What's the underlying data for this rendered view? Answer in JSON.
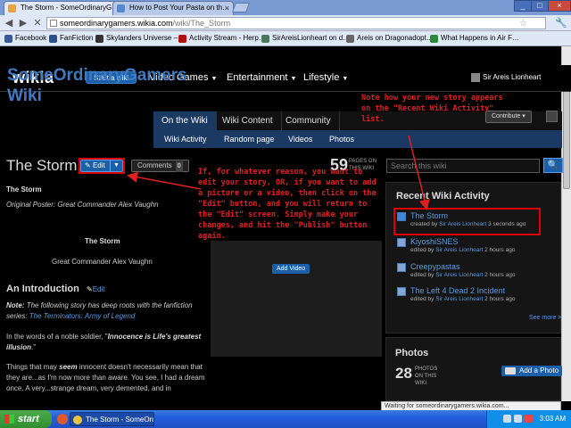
{
  "browser": {
    "tabs": [
      {
        "label": "The Storm - SomeOrdinaryG…",
        "active": true
      },
      {
        "label": "How to Post Your Pasta on th…",
        "active": false
      }
    ],
    "url_host": "someordinarygamers.wikia.com",
    "url_path": "/wiki/The_Storm",
    "bookmarks": [
      {
        "label": "Facebook",
        "color": "#3b5998"
      },
      {
        "label": "FanFiction",
        "color": "#2a4f8a"
      },
      {
        "label": "Skylanders Universe –…",
        "color": "#333333"
      },
      {
        "label": "Activity Stream - Herp…",
        "color": "#b01010"
      },
      {
        "label": "SirAreisLionheart on d…",
        "color": "#4a7a5a"
      },
      {
        "label": "Areis on Dragonadopt…",
        "color": "#666666"
      },
      {
        "label": "What Happens in Air F…",
        "color": "#2a8a3a"
      }
    ],
    "status_text": "Waiting for someordinarygamers.wikia.com..."
  },
  "wikia": {
    "logo": "wikia",
    "start_wiki": "Start a wiki",
    "hubs": [
      "Video Games",
      "Entertainment",
      "Lifestyle"
    ],
    "user": "Sir Areis Lionheart"
  },
  "wiki": {
    "title": "SomeOrdinaryGamers Wiki",
    "tabs": [
      "On the Wiki",
      "Wiki Content",
      "Community"
    ],
    "subtabs": [
      "Wiki Activity",
      "Random page",
      "Videos",
      "Photos"
    ],
    "contribute": "Contribute"
  },
  "article": {
    "title": "The Storm",
    "edit_label": "Edit",
    "comments_label": "Comments",
    "comments_count": "0",
    "pages_count": "59",
    "pages_label": "PAGES ON THIS WIKI",
    "search_placeholder": "Search this wiki",
    "heading_bold": "The Storm",
    "original_poster": "Original Poster: Great Commander Alex Vaughn",
    "center_title": "The Storm",
    "center_author": "Great Commander Alex Vaughn",
    "add_video": "Add Video",
    "intro_heading": "An Introduction",
    "intro_edit": "Edit",
    "note_label": "Note:",
    "note_text": "The following story has deep roots with the fanfiction series:",
    "note_link": "The Terminators: Army of Legend",
    "para1_start": "In the words of a noble soldier, \"",
    "para1_bold": "Innocence is Life's greatest illusion",
    "para1_end": ".\"",
    "para2_start": "Things that may ",
    "para2_bold": "seem",
    "para2_rest": " innocent doesn't necessarily mean that they are...as I'm now more than aware. You see, I had a dream once. A very...strange dream, very demented, and in"
  },
  "annotations": {
    "top_right": "Note how your new story appears on the \"Recent Wiki Activity\" list.",
    "middle": "If, for whatever reason, you want to edit your story, OR, if you want to add a picture or a video, then click on the \"Edit\" button, and you will return to the \"Edit\" screen. Simply make your changes, and hit the \"Publish\" button again."
  },
  "activity": {
    "heading": "Recent Wiki Activity",
    "items": [
      {
        "title": "The Storm",
        "meta_prefix": "created by ",
        "user": "Sir Areis Lionheart",
        "time": " 3 seconds ago"
      },
      {
        "title": "KiyoshiSNES",
        "meta_prefix": "edited by ",
        "user": "Sir Areis Lionheart",
        "time": " 2 hours ago"
      },
      {
        "title": "Creepypastas",
        "meta_prefix": "edited by ",
        "user": "Sir Areis Lionheart",
        "time": " 2 hours ago"
      },
      {
        "title": "The Left 4 Dead 2 Incident",
        "meta_prefix": "edited by ",
        "user": "Sir Areis Lionheart",
        "time": " 2 hours ago"
      }
    ],
    "see_more": "See more >"
  },
  "photos": {
    "heading": "Photos",
    "count": "28",
    "count_label": "PHOTOS ON THIS WIKI",
    "add_photo": "Add a Photo"
  },
  "taskbar": {
    "start": "start",
    "task": "The Storm - SomeOrd...",
    "clock": "3:03 AM"
  },
  "colors": {
    "wiki_blue": "#3f79c2",
    "link_blue": "#5a9ae0",
    "annotation_red": "#e02020"
  }
}
